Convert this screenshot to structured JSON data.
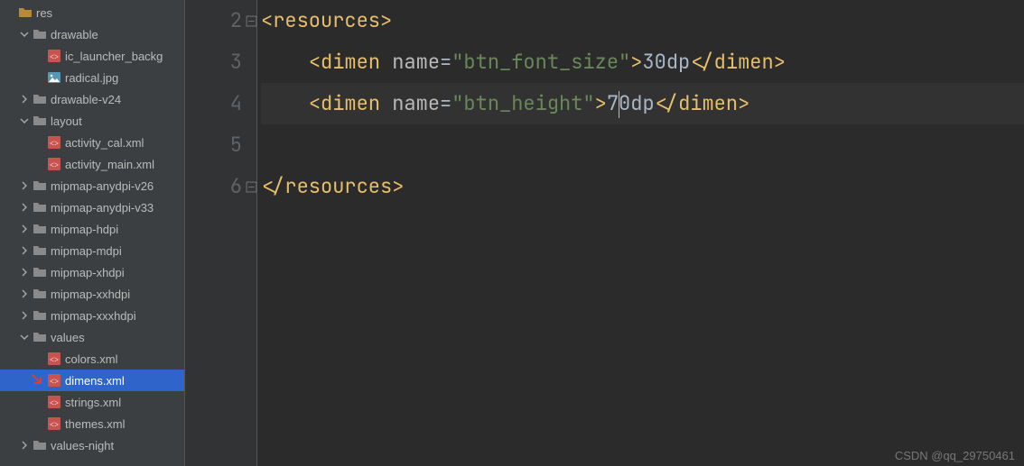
{
  "sidebar": {
    "tree": [
      {
        "depth": 0,
        "kind": "folder-open",
        "arrow": "none",
        "label": "res",
        "iconTint": "b58b38"
      },
      {
        "depth": 1,
        "kind": "folder-open",
        "arrow": "down",
        "label": "drawable"
      },
      {
        "depth": 2,
        "kind": "xml",
        "arrow": "none",
        "label": "ic_launcher_backg"
      },
      {
        "depth": 2,
        "kind": "image",
        "arrow": "none",
        "label": "radical.jpg"
      },
      {
        "depth": 1,
        "kind": "folder",
        "arrow": "right",
        "label": "drawable-v24"
      },
      {
        "depth": 1,
        "kind": "folder-open",
        "arrow": "down",
        "label": "layout"
      },
      {
        "depth": 2,
        "kind": "xml",
        "arrow": "none",
        "label": "activity_cal.xml"
      },
      {
        "depth": 2,
        "kind": "xml",
        "arrow": "none",
        "label": "activity_main.xml"
      },
      {
        "depth": 1,
        "kind": "folder",
        "arrow": "right",
        "label": "mipmap-anydpi-v26"
      },
      {
        "depth": 1,
        "kind": "folder",
        "arrow": "right",
        "label": "mipmap-anydpi-v33"
      },
      {
        "depth": 1,
        "kind": "folder",
        "arrow": "right",
        "label": "mipmap-hdpi"
      },
      {
        "depth": 1,
        "kind": "folder",
        "arrow": "right",
        "label": "mipmap-mdpi"
      },
      {
        "depth": 1,
        "kind": "folder",
        "arrow": "right",
        "label": "mipmap-xhdpi"
      },
      {
        "depth": 1,
        "kind": "folder",
        "arrow": "right",
        "label": "mipmap-xxhdpi"
      },
      {
        "depth": 1,
        "kind": "folder",
        "arrow": "right",
        "label": "mipmap-xxxhdpi"
      },
      {
        "depth": 1,
        "kind": "folder-open",
        "arrow": "down",
        "label": "values"
      },
      {
        "depth": 2,
        "kind": "xml",
        "arrow": "none",
        "label": "colors.xml"
      },
      {
        "depth": 2,
        "kind": "xml",
        "arrow": "none",
        "label": "dimens.xml",
        "selected": true,
        "redArrow": true
      },
      {
        "depth": 2,
        "kind": "xml",
        "arrow": "none",
        "label": "strings.xml"
      },
      {
        "depth": 2,
        "kind": "xml",
        "arrow": "none",
        "label": "themes.xml"
      },
      {
        "depth": 1,
        "kind": "folder",
        "arrow": "right",
        "label": "values-night"
      }
    ]
  },
  "editor": {
    "firstLineNumber": 2,
    "lineCount": 5,
    "currentLineIndex": 2,
    "lines": [
      [
        {
          "t": "<",
          "c": "tag-br"
        },
        {
          "t": "resources",
          "c": "tag-name"
        },
        {
          "t": ">",
          "c": "tag-br"
        }
      ],
      [
        {
          "t": "    ",
          "c": "txt"
        },
        {
          "t": "<",
          "c": "tag-br"
        },
        {
          "t": "dimen ",
          "c": "tag-name"
        },
        {
          "t": "name",
          "c": "attr"
        },
        {
          "t": "=",
          "c": "eq"
        },
        {
          "t": "\"btn_font_size\"",
          "c": "str"
        },
        {
          "t": ">",
          "c": "tag-br"
        },
        {
          "t": "30dp",
          "c": "txt"
        },
        {
          "t": "</",
          "c": "tag-br"
        },
        {
          "t": "dimen",
          "c": "tag-name"
        },
        {
          "t": ">",
          "c": "tag-br"
        }
      ],
      [
        {
          "t": "    ",
          "c": "txt"
        },
        {
          "t": "<",
          "c": "tag-br"
        },
        {
          "t": "dimen ",
          "c": "tag-name"
        },
        {
          "t": "name",
          "c": "attr"
        },
        {
          "t": "=",
          "c": "eq"
        },
        {
          "t": "\"btn_height\"",
          "c": "str"
        },
        {
          "t": ">",
          "c": "tag-br"
        },
        {
          "t": "7",
          "c": "txt"
        },
        {
          "t": "CARET",
          "c": "caret"
        },
        {
          "t": "0dp",
          "c": "txt"
        },
        {
          "t": "</",
          "c": "tag-br"
        },
        {
          "t": "dimen",
          "c": "tag-name"
        },
        {
          "t": ">",
          "c": "tag-br"
        }
      ],
      [],
      [
        {
          "t": "</",
          "c": "tag-br"
        },
        {
          "t": "resources",
          "c": "tag-name"
        },
        {
          "t": ">",
          "c": "tag-br"
        }
      ]
    ]
  },
  "watermark": "CSDN @qq_29750461"
}
